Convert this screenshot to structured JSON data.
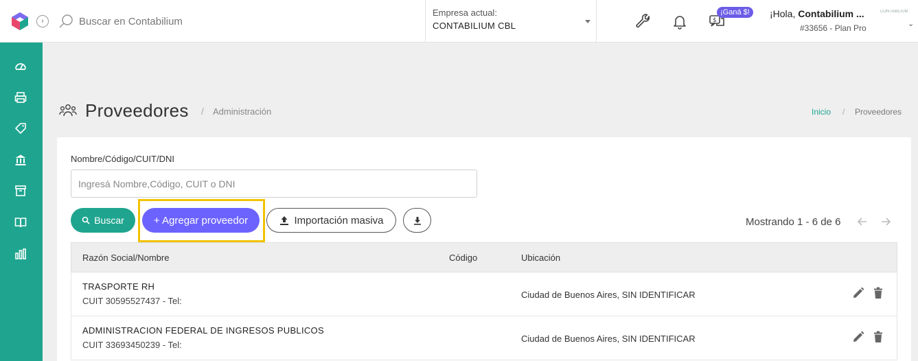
{
  "topbar": {
    "search_placeholder": "Buscar en Contabilium",
    "company_label": "Empresa actual:",
    "company_value": "CONTABILIUM CBL",
    "promo_badge": "¡Ganá $!",
    "greeting_prefix": "¡Hola, ",
    "greeting_name": "Contabilium ...",
    "user_meta": "#33656 - Plan Pro",
    "avatar_text": "CONTABILIUM"
  },
  "page": {
    "title": "Proveedores",
    "separator": "/",
    "subtitle": "Administración",
    "breadcrumb_home": "Inicio",
    "breadcrumb_sep": "/",
    "breadcrumb_current": "Proveedores"
  },
  "filter": {
    "label": "Nombre/Código/CUIT/DNI",
    "placeholder": "Ingresá Nombre,Código, CUIT o DNI",
    "value": ""
  },
  "actions": {
    "search_label": "Buscar",
    "add_label": "+ Agregar proveedor",
    "import_label": "Importación masiva"
  },
  "pager": {
    "text": "Mostrando 1 - 6 de 6"
  },
  "table": {
    "columns": [
      "Razón Social/Nombre",
      "Código",
      "Ubicación"
    ],
    "rows": [
      {
        "name": "TRASPORTE RH",
        "sub": "CUIT 30595527437 - Tel:",
        "code": "",
        "location": "Ciudad de Buenos Aires, SIN IDENTIFICAR"
      },
      {
        "name": "ADMINISTRACION FEDERAL DE INGRESOS PUBLICOS",
        "sub": "CUIT 33693450239 - Tel:",
        "code": "",
        "location": "Ciudad de Buenos Aires, SIN IDENTIFICAR"
      }
    ]
  },
  "colors": {
    "primary": "#1fa58f",
    "accent": "#6c63ff",
    "highlight": "#f2c200"
  }
}
